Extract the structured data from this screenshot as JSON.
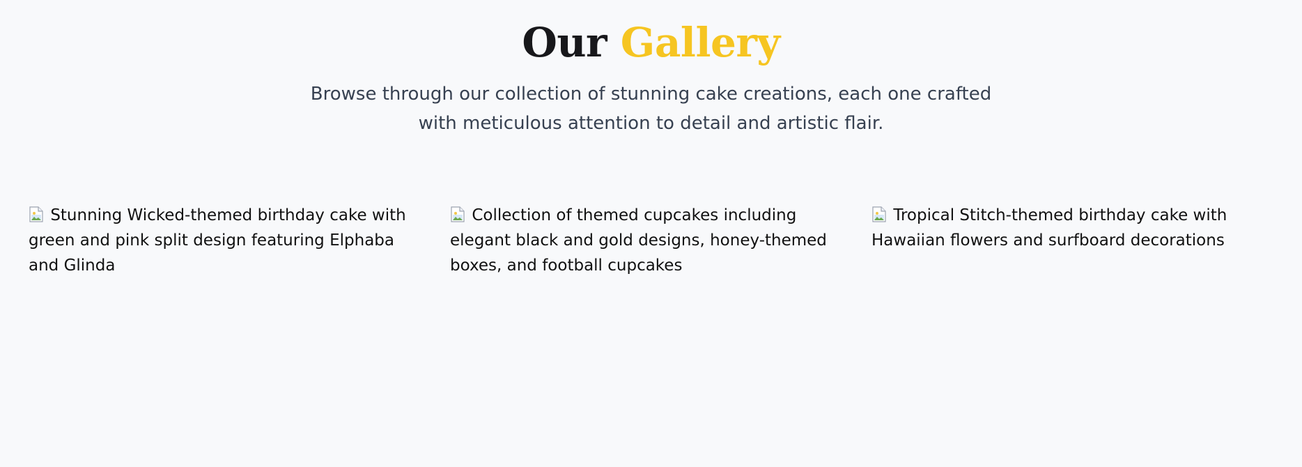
{
  "header": {
    "title_part1": "Our",
    "title_part2": "Gallery",
    "subtitle": "Browse through our collection of stunning cake creations, each one crafted with meticulous attention to detail and artistic flair."
  },
  "gallery": {
    "items": [
      {
        "alt": "Stunning Wicked-themed birthday cake with green and pink split design featuring Elphaba and Glinda",
        "icon": "broken-image-icon"
      },
      {
        "alt": "Collection of themed cupcakes including elegant black and gold designs, honey-themed boxes, and football cupcakes",
        "icon": "broken-image-icon"
      },
      {
        "alt": "Tropical Stitch-themed birthday cake with Hawaiian flowers and surfboard decorations",
        "icon": "broken-image-icon"
      }
    ]
  },
  "colors": {
    "background": "#f8f9fb",
    "title": "#18181b",
    "accent": "#f6c521",
    "subtitle": "#374151"
  }
}
